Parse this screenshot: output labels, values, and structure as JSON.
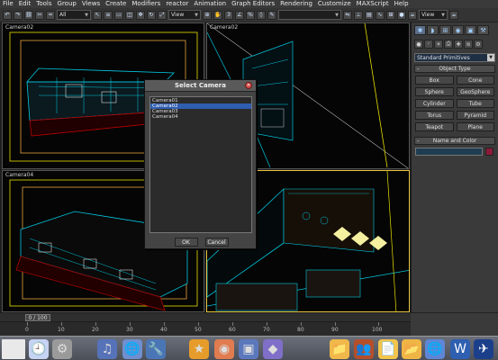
{
  "menubar": [
    "File",
    "Edit",
    "Tools",
    "Group",
    "Views",
    "Create",
    "Modifiers",
    "reactor",
    "Animation",
    "Graph Editors",
    "Rendering",
    "Customize",
    "MAXScript",
    "Help"
  ],
  "toolbar": {
    "selection_filter": "All",
    "reference_coord": "View",
    "view_dropdown_2": "View"
  },
  "viewports": [
    {
      "label": "Camera02"
    },
    {
      "label": "Camera02"
    },
    {
      "label": "Camera04"
    },
    {
      "label": ""
    }
  ],
  "dialog": {
    "title": "Select Camera",
    "items": [
      "Camera01",
      "Camera02",
      "Camera03",
      "Camera04"
    ],
    "selected_index": 1,
    "ok_label": "OK",
    "cancel_label": "Cancel"
  },
  "command_panel": {
    "category_dropdown": "Standard Primitives",
    "object_type_title": "Object Type",
    "primitives": [
      "Box",
      "Cone",
      "Sphere",
      "GeoSphere",
      "Cylinder",
      "Tube",
      "Torus",
      "Pyramid",
      "Teapot",
      "Plane"
    ],
    "name_color_title": "Name and Color",
    "color_swatch": "#8c1a3a"
  },
  "timeline": {
    "frame_display": "0 / 100",
    "ticks": [
      "0",
      "10",
      "20",
      "30",
      "40",
      "50",
      "60",
      "70",
      "80",
      "90",
      "100"
    ]
  },
  "colors": {
    "wireframe": "#00c8e0",
    "wireframe_yellow": "#e8e000",
    "viewport_frame": "#e7c33c",
    "selection": "#2f5db0"
  }
}
